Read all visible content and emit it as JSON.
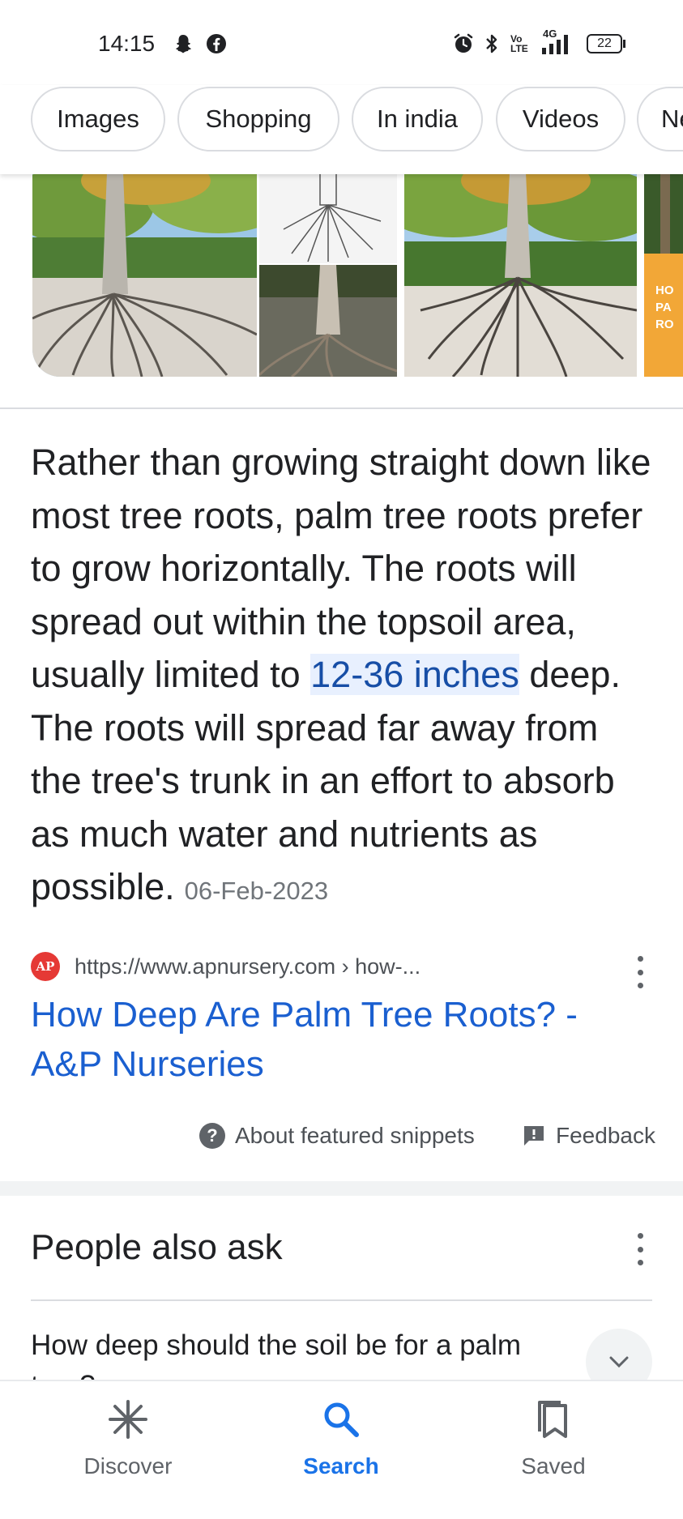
{
  "status_bar": {
    "time": "14:15",
    "left_icons": [
      "snapchat-icon",
      "facebook-icon"
    ],
    "right_icons": [
      "alarm-icon",
      "bluetooth-icon",
      "volte-icon",
      "4g-signal-icon"
    ],
    "volte_text": "Vo LTE",
    "network_text": "4G",
    "battery": "22"
  },
  "filter_chips": [
    "Images",
    "Shopping",
    "In india",
    "Videos",
    "Ne"
  ],
  "image_strip": {
    "partial_card_text": "HO PA RO",
    "colors": {
      "sky": "#9cc7e6",
      "foliage": "#4e7d35",
      "sand": "#d9d4cc",
      "card_orange": "#f2a737"
    }
  },
  "snippet": {
    "text_before": "Rather than growing straight down like most tree roots, palm tree roots prefer to grow horizontally. The roots will spread out within the topsoil area, usually limited to ",
    "highlight": "12-36 inches",
    "text_after": " deep. The roots will spread far away from the tree's trunk in an effort to absorb as much water and nutrients as possible.",
    "date": "06-Feb-2023"
  },
  "source": {
    "favicon_text": "AP",
    "url": "https://www.apnursery.com › how-...",
    "title": "How Deep Are Palm Tree Roots? - A&P Nurseries"
  },
  "snippet_footer": {
    "about_label": "About featured snippets",
    "feedback_label": "Feedback"
  },
  "people_also_ask": {
    "title": "People also ask",
    "first_question": "How deep should the soil be for a palm tree?"
  },
  "bottom_nav": {
    "items": [
      {
        "label": "Discover",
        "icon": "asterisk-icon"
      },
      {
        "label": "Search",
        "icon": "search-icon"
      },
      {
        "label": "Saved",
        "icon": "bookmarks-icon"
      }
    ],
    "active": "Search",
    "colors": {
      "active": "#1a73e8",
      "inactive": "#5f6368"
    }
  }
}
